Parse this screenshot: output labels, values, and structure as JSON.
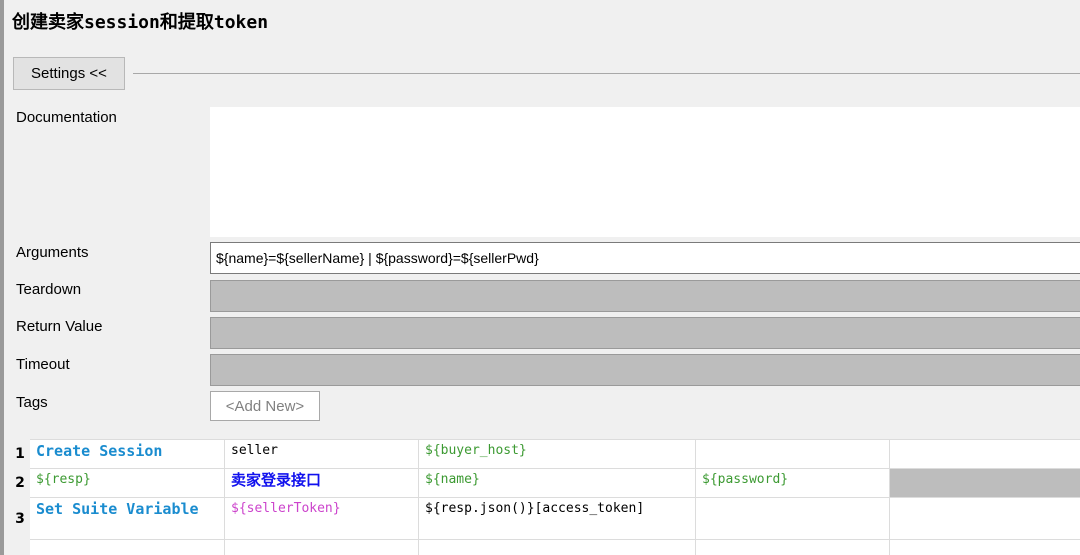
{
  "page_title": "创建卖家session和提取token",
  "settings_button": "Settings <<",
  "labels": {
    "documentation": "Documentation",
    "arguments": "Arguments",
    "teardown": "Teardown",
    "return_value": "Return Value",
    "timeout": "Timeout",
    "tags": "Tags"
  },
  "fields": {
    "documentation": "",
    "arguments": "${name}=${sellerName} | ${password}=${sellerPwd}",
    "teardown": "",
    "return_value": "",
    "timeout": "",
    "tags_add_new": "<Add New>"
  },
  "colors": {
    "keyword": "#1a8ccf",
    "variable": "#3c9a32",
    "assigned_variable": "#cc44cc",
    "user_keyword": "#1111ee",
    "disabled_field": "#bdbdbd"
  },
  "table": {
    "rows": [
      {
        "num": "1",
        "cells": [
          "Create Session",
          "seller",
          "${buyer_host}",
          ""
        ]
      },
      {
        "num": "2",
        "cells": [
          "${resp}",
          "卖家登录接口",
          "${name}",
          "${password}"
        ]
      },
      {
        "num": "3",
        "cells": [
          "Set Suite Variable",
          "${sellerToken}",
          "${resp.json()}[access_token]",
          ""
        ]
      }
    ]
  }
}
